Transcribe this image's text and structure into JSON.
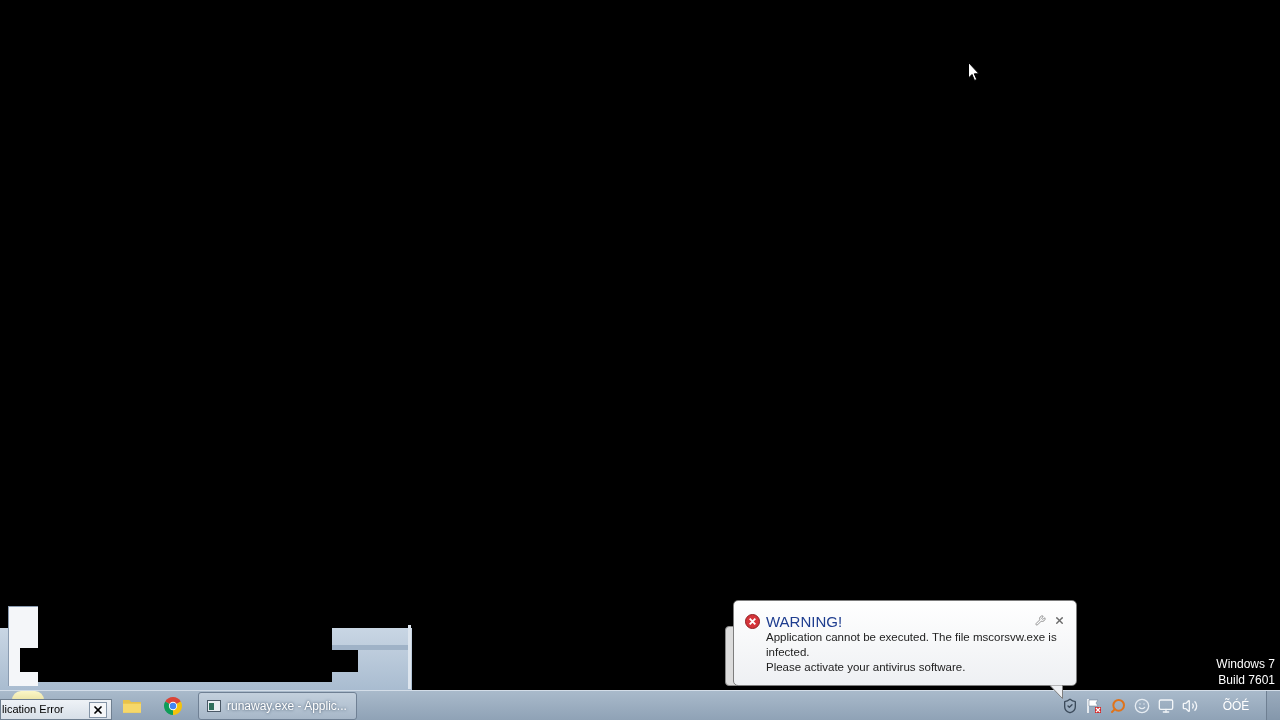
{
  "desktop": {
    "os_label": [
      "Windows 7",
      "Build 7601"
    ]
  },
  "error_window": {
    "title": "lication Error"
  },
  "taskbar": {
    "tasks": [
      {
        "label": "runaway.exe - Applic..."
      }
    ],
    "clock": "ÕÓÉ"
  },
  "balloon": {
    "title": "WARNING!",
    "lines": [
      "Application cannot be executed. The file mscorsvw.exe is infected.",
      "Please activate your antivirus software."
    ]
  }
}
